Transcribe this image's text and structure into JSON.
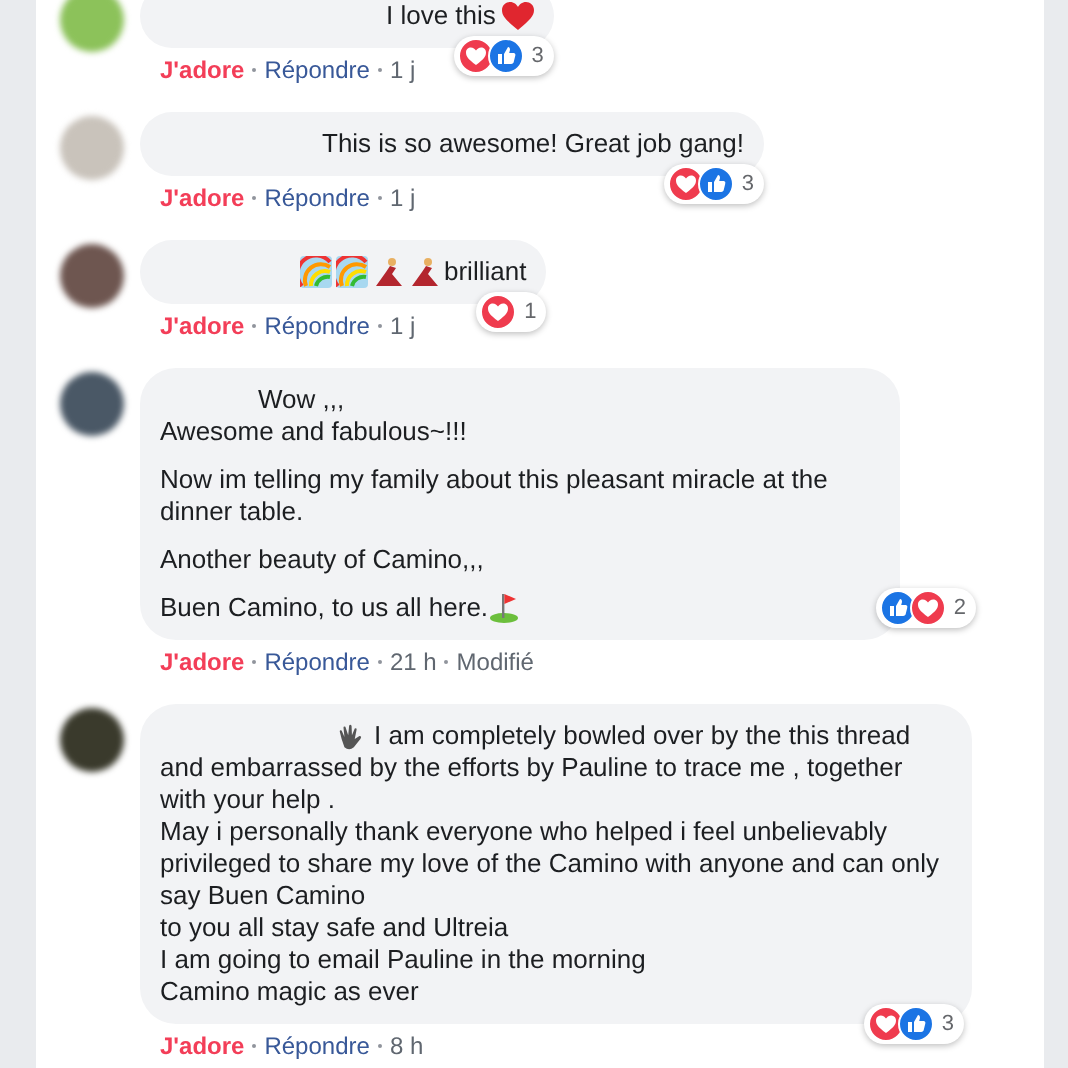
{
  "comments": [
    {
      "avatar": {
        "color": "#8cc25a"
      },
      "text": "I love this",
      "trailing_icon": {
        "kind": "heart"
      },
      "reactions": {
        "icons": [
          {
            "kind": "love"
          },
          {
            "kind": "like"
          }
        ],
        "count": "3"
      },
      "meta": {
        "reaction": "J'adore",
        "reacted": true,
        "reply": "Répondre",
        "time": "1 j"
      }
    },
    {
      "avatar": {
        "color": "#c9c3bb"
      },
      "text": "This is so awesome! Great job gang!",
      "reactions": {
        "icons": [
          {
            "kind": "love"
          },
          {
            "kind": "like"
          }
        ],
        "count": "3"
      },
      "meta": {
        "reaction": "J'adore",
        "reacted": true,
        "reply": "Répondre",
        "time": "1 j"
      }
    },
    {
      "avatar": {
        "color": "#6e5650"
      },
      "leading_icons": [
        {
          "kind": "rainbow"
        },
        {
          "kind": "rainbow"
        },
        {
          "kind": "dancer"
        },
        {
          "kind": "dancer"
        }
      ],
      "text": "brilliant",
      "reactions": {
        "icons": [
          {
            "kind": "love"
          }
        ],
        "count": "1"
      },
      "meta": {
        "reaction": "J'adore",
        "reacted": true,
        "reply": "Répondre",
        "time": "1 j"
      }
    },
    {
      "avatar": {
        "color": "#4a5866"
      },
      "paragraphs": [
        "Wow ,,,",
        "Awesome and fabulous~!!!",
        "Now im telling my family about this pleasant miracle at the dinner table.",
        "Another beauty of Camino,,,",
        "Buen Camino, to us all here."
      ],
      "trailing_icon": {
        "kind": "flag"
      },
      "reactions": {
        "icons": [
          {
            "kind": "like"
          },
          {
            "kind": "love"
          }
        ],
        "count": "2"
      },
      "meta": {
        "reaction": "J'adore",
        "reacted": true,
        "reply": "Répondre",
        "time": "21 h",
        "edited": "Modifié"
      }
    },
    {
      "avatar": {
        "color": "#3a3a2c"
      },
      "leading_icons": [
        {
          "kind": "hand"
        }
      ],
      "lines": [
        "I am completely bowled over by the this thread",
        "and embarrassed by the efforts by Pauline to trace me , together with your help .",
        "May i personally thank everyone who helped i feel unbelievably privileged to share my love of the Camino with anyone and can only say Buen Camino",
        "to you all stay safe and Ultreia",
        "I am going to email Pauline in the morning",
        "Camino magic as ever"
      ],
      "reactions": {
        "icons": [
          {
            "kind": "love"
          },
          {
            "kind": "like"
          }
        ],
        "count": "3"
      },
      "meta": {
        "reaction": "J'adore",
        "reacted": true,
        "reply": "Répondre",
        "time": "8 h"
      }
    }
  ]
}
